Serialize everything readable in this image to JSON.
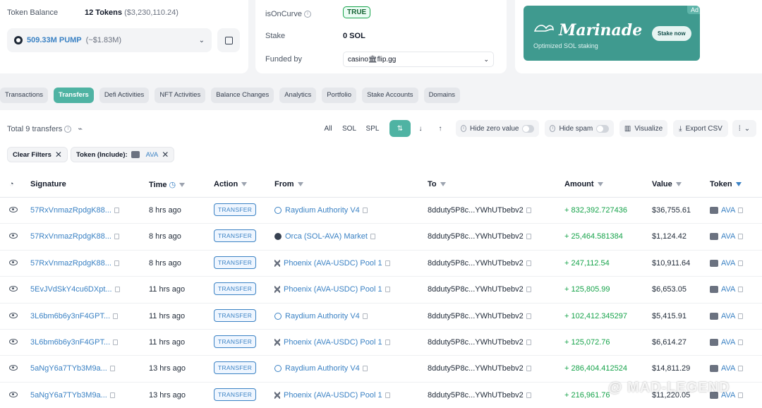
{
  "balance": {
    "label": "Token Balance",
    "count": "12 Tokens",
    "total_value": "($3,230,110.24)",
    "selected_amount": "509.33M PUMP",
    "selected_value": "(~$1.83M)"
  },
  "info": {
    "isoncurve_label": "isOnCurve",
    "isoncurve_value": "TRUE",
    "stake_label": "Stake",
    "stake_value": "0 SOL",
    "funded_label": "Funded by",
    "funded_value": "casino🏛flip.gg"
  },
  "ad": {
    "tag": "Ad",
    "title": "Marinade",
    "subtitle": "Optimized SOL staking",
    "cta": "Stake now"
  },
  "tabs": [
    "Transactions",
    "Transfers",
    "Defi Activities",
    "NFT Activities",
    "Balance Changes",
    "Analytics",
    "Portfolio",
    "Stake Accounts",
    "Domains"
  ],
  "toolbar": {
    "total": "Total 9 transfers",
    "all": "All",
    "sol": "SOL",
    "spl": "SPL",
    "hide_zero": "Hide zero value",
    "hide_spam": "Hide spam",
    "visualize": "Visualize",
    "export": "Export CSV"
  },
  "filters": {
    "clear": "Clear Filters",
    "token_filter_label": "Token (Include):",
    "token_filter_value": "AVA"
  },
  "columns": {
    "signature": "Signature",
    "time": "Time",
    "action": "Action",
    "from": "From",
    "to": "To",
    "amount": "Amount",
    "value": "Value",
    "token": "Token"
  },
  "rows": [
    {
      "sig": "57RxVnmazRpdgK88...",
      "time": "8 hrs ago",
      "action": "TRANSFER",
      "from": "Raydium Authority V4",
      "to": "8dduty5P8c...YWhUTbebv2",
      "amount": "+ 832,392.727436",
      "value": "$36,755.61",
      "token": "AVA"
    },
    {
      "sig": "57RxVnmazRpdgK88...",
      "time": "8 hrs ago",
      "action": "TRANSFER",
      "from": "Orca (SOL-AVA) Market",
      "to": "8dduty5P8c...YWhUTbebv2",
      "amount": "+ 25,464.581384",
      "value": "$1,124.42",
      "token": "AVA"
    },
    {
      "sig": "57RxVnmazRpdgK88...",
      "time": "8 hrs ago",
      "action": "TRANSFER",
      "from": "Phoenix (AVA-USDC) Pool 1",
      "to": "8dduty5P8c...YWhUTbebv2",
      "amount": "+ 247,112.54",
      "value": "$10,911.64",
      "token": "AVA"
    },
    {
      "sig": "5EvJVdSkY4cu6DXpt...",
      "time": "11 hrs ago",
      "action": "TRANSFER",
      "from": "Phoenix (AVA-USDC) Pool 1",
      "to": "8dduty5P8c...YWhUTbebv2",
      "amount": "+ 125,805.99",
      "value": "$6,653.05",
      "token": "AVA"
    },
    {
      "sig": "3L6bm6b6y3nF4GPT...",
      "time": "11 hrs ago",
      "action": "TRANSFER",
      "from": "Raydium Authority V4",
      "to": "8dduty5P8c...YWhUTbebv2",
      "amount": "+ 102,412.345297",
      "value": "$5,415.91",
      "token": "AVA"
    },
    {
      "sig": "3L6bm6b6y3nF4GPT...",
      "time": "11 hrs ago",
      "action": "TRANSFER",
      "from": "Phoenix (AVA-USDC) Pool 1",
      "to": "8dduty5P8c...YWhUTbebv2",
      "amount": "+ 125,072.76",
      "value": "$6,614.27",
      "token": "AVA"
    },
    {
      "sig": "5aNgY6a7TYb3M9a...",
      "time": "13 hrs ago",
      "action": "TRANSFER",
      "from": "Raydium Authority V4",
      "to": "8dduty5P8c...YWhUTbebv2",
      "amount": "+ 286,404.412524",
      "value": "$14,811.29",
      "token": "AVA"
    },
    {
      "sig": "5aNgY6a7TYb3M9a...",
      "time": "13 hrs ago",
      "action": "TRANSFER",
      "from": "Phoenix (AVA-USDC) Pool 1",
      "to": "8dduty5P8c...YWhUTbebv2",
      "amount": "+ 216,961.76",
      "value": "$11,220.05",
      "token": "AVA"
    }
  ],
  "watermark": "@ MAD-LEGEND"
}
